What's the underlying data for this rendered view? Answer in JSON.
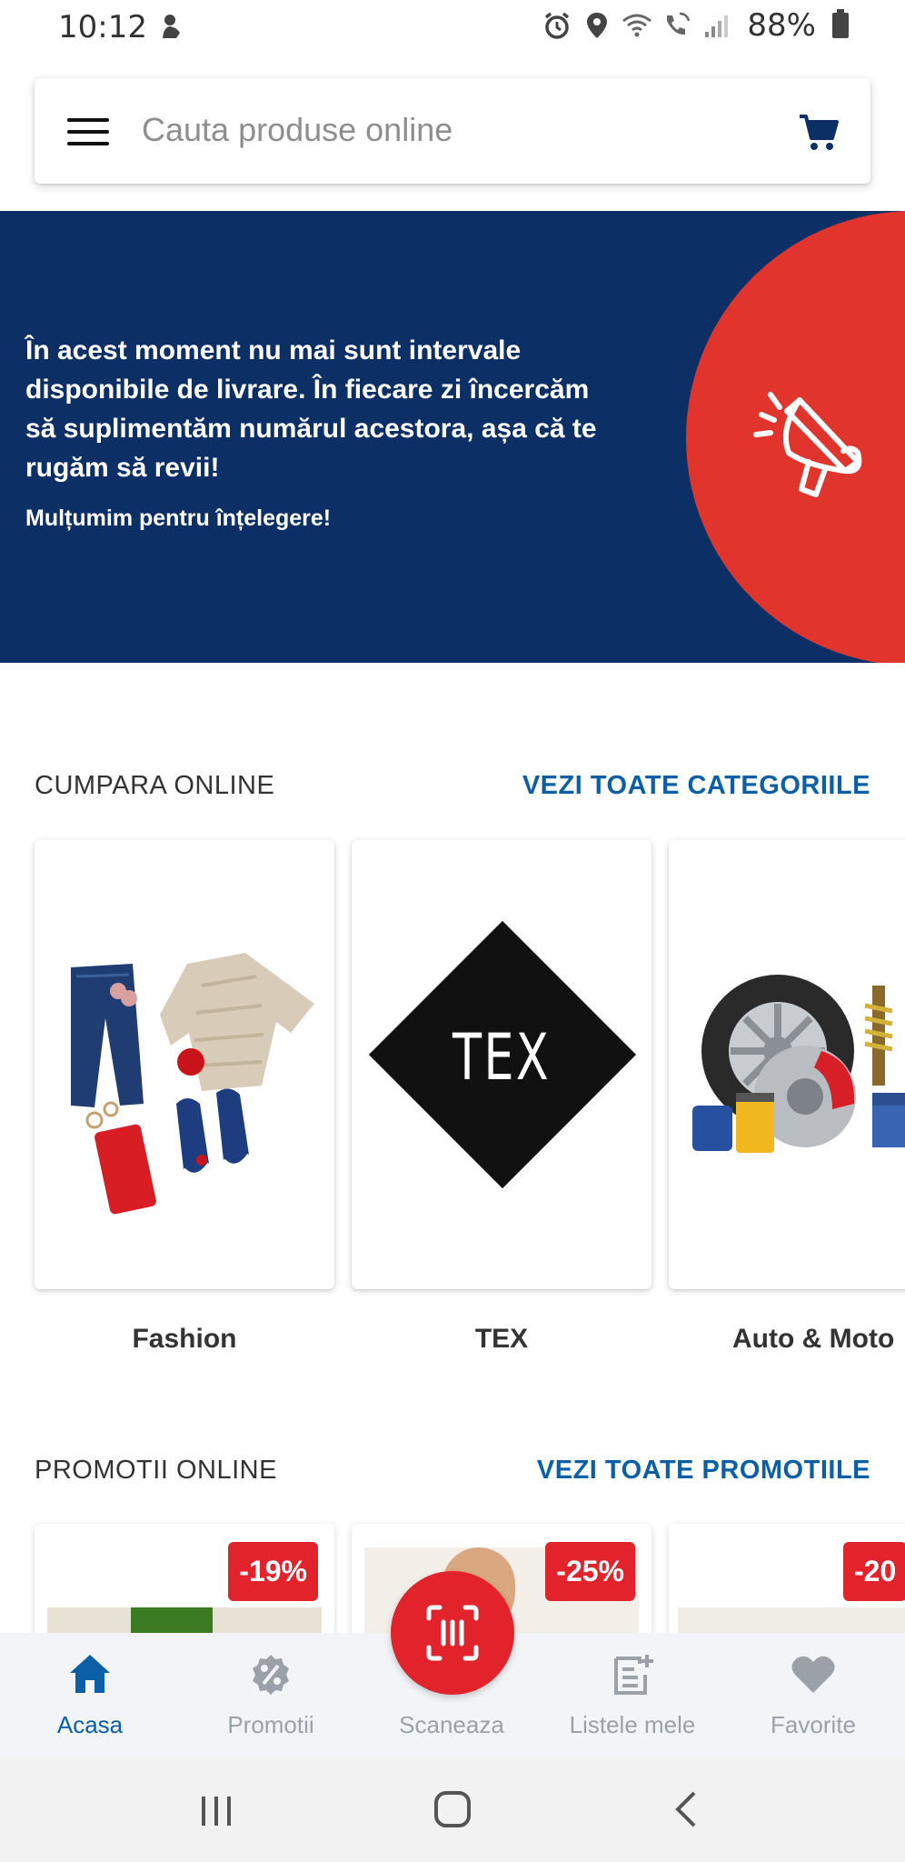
{
  "status_bar": {
    "time": "10:12",
    "battery": "88%"
  },
  "search": {
    "placeholder": "Cauta produse online"
  },
  "banner": {
    "message": "În acest moment nu mai sunt intervale disponibile de livrare. În fiecare zi încercăm să suplimentăm numărul acestora, așa că te rugăm să revii!",
    "thanks": "Mulțumim pentru înțelegere!"
  },
  "shop_online": {
    "title": "CUMPARA ONLINE",
    "link": "VEZI TOATE CATEGORIILE",
    "categories": [
      {
        "label": "Fashion"
      },
      {
        "label": "TEX",
        "logo_text": "TEX"
      },
      {
        "label": "Auto & Moto"
      }
    ]
  },
  "promotions": {
    "title": "PROMOTII ONLINE",
    "link": "VEZI TOATE PROMOTIILE",
    "items": [
      {
        "discount": "-19%"
      },
      {
        "discount": "-25%"
      },
      {
        "discount": "-20"
      }
    ]
  },
  "bottom_nav": {
    "items": [
      {
        "label": "Acasa",
        "icon": "home-icon",
        "active": true
      },
      {
        "label": "Promotii",
        "icon": "percent-badge-icon",
        "active": false
      },
      {
        "label": "Scaneaza",
        "icon": "barcode-scan-icon",
        "active": false
      },
      {
        "label": "Listele mele",
        "icon": "list-add-icon",
        "active": false
      },
      {
        "label": "Favorite",
        "icon": "heart-icon",
        "active": false
      }
    ]
  },
  "colors": {
    "brand_blue": "#0c2f66",
    "accent_red": "#e0342c",
    "link_blue": "#0b5fa6",
    "badge_red": "#e3232b"
  }
}
